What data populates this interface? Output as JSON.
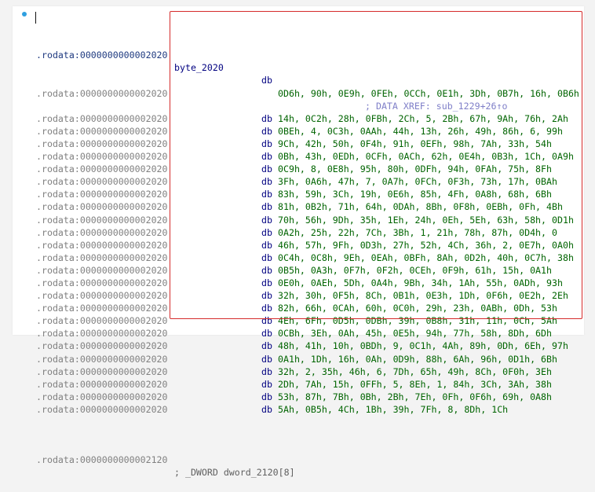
{
  "accent": "#d52b2b",
  "listing": {
    "label": "byte_2020",
    "operator": "db",
    "xref": "; DATA XREF: sub_1229+26↑o",
    "first_address": ".rodata:0000000000002020",
    "rows": [
      {
        "addr": ".rodata:0000000000002020",
        "vals": "0D6h, 90h, 0E9h, 0FEh, 0CCh, 0E1h, 3Dh, 0B7h, 16h, 0B6h"
      },
      {
        "addr": ".rodata:0000000000002020",
        "vals": ""
      },
      {
        "addr": ".rodata:0000000000002020",
        "vals": "14h, 0C2h, 28h, 0FBh, 2Ch, 5, 2Bh, 67h, 9Ah, 76h, 2Ah"
      },
      {
        "addr": ".rodata:0000000000002020",
        "vals": "0BEh, 4, 0C3h, 0AAh, 44h, 13h, 26h, 49h, 86h, 6, 99h"
      },
      {
        "addr": ".rodata:0000000000002020",
        "vals": "9Ch, 42h, 50h, 0F4h, 91h, 0EFh, 98h, 7Ah, 33h, 54h"
      },
      {
        "addr": ".rodata:0000000000002020",
        "vals": "0Bh, 43h, 0EDh, 0CFh, 0ACh, 62h, 0E4h, 0B3h, 1Ch, 0A9h"
      },
      {
        "addr": ".rodata:0000000000002020",
        "vals": "0C9h, 8, 0E8h, 95h, 80h, 0DFh, 94h, 0FAh, 75h, 8Fh"
      },
      {
        "addr": ".rodata:0000000000002020",
        "vals": "3Fh, 0A6h, 47h, 7, 0A7h, 0FCh, 0F3h, 73h, 17h, 0BAh"
      },
      {
        "addr": ".rodata:0000000000002020",
        "vals": "83h, 59h, 3Ch, 19h, 0E6h, 85h, 4Fh, 0A8h, 68h, 6Bh"
      },
      {
        "addr": ".rodata:0000000000002020",
        "vals": "81h, 0B2h, 71h, 64h, 0DAh, 8Bh, 0F8h, 0EBh, 0Fh, 4Bh"
      },
      {
        "addr": ".rodata:0000000000002020",
        "vals": "70h, 56h, 9Dh, 35h, 1Eh, 24h, 0Eh, 5Eh, 63h, 58h, 0D1h"
      },
      {
        "addr": ".rodata:0000000000002020",
        "vals": "0A2h, 25h, 22h, 7Ch, 3Bh, 1, 21h, 78h, 87h, 0D4h, 0"
      },
      {
        "addr": ".rodata:0000000000002020",
        "vals": "46h, 57h, 9Fh, 0D3h, 27h, 52h, 4Ch, 36h, 2, 0E7h, 0A0h"
      },
      {
        "addr": ".rodata:0000000000002020",
        "vals": "0C4h, 0C8h, 9Eh, 0EAh, 0BFh, 8Ah, 0D2h, 40h, 0C7h, 38h"
      },
      {
        "addr": ".rodata:0000000000002020",
        "vals": "0B5h, 0A3h, 0F7h, 0F2h, 0CEh, 0F9h, 61h, 15h, 0A1h"
      },
      {
        "addr": ".rodata:0000000000002020",
        "vals": "0E0h, 0AEh, 5Dh, 0A4h, 9Bh, 34h, 1Ah, 55h, 0ADh, 93h"
      },
      {
        "addr": ".rodata:0000000000002020",
        "vals": "32h, 30h, 0F5h, 8Ch, 0B1h, 0E3h, 1Dh, 0F6h, 0E2h, 2Eh"
      },
      {
        "addr": ".rodata:0000000000002020",
        "vals": "82h, 66h, 0CAh, 60h, 0C0h, 29h, 23h, 0ABh, 0Dh, 53h"
      },
      {
        "addr": ".rodata:0000000000002020",
        "vals": "4Eh, 6Fh, 0D5h, 0DBh, 39h, 0B8h, 31h, 11h, 0Ch, 5Ah"
      },
      {
        "addr": ".rodata:0000000000002020",
        "vals": "0CBh, 3Eh, 0Ah, 45h, 0E5h, 94h, 77h, 58h, 8Dh, 6Dh"
      },
      {
        "addr": ".rodata:0000000000002020",
        "vals": "48h, 41h, 10h, 0BDh, 9, 0C1h, 4Ah, 89h, 0Dh, 6Eh, 97h"
      },
      {
        "addr": ".rodata:0000000000002020",
        "vals": "0A1h, 1Dh, 16h, 0Ah, 0D9h, 88h, 6Ah, 96h, 0D1h, 6Bh"
      },
      {
        "addr": ".rodata:0000000000002020",
        "vals": "32h, 2, 35h, 46h, 6, 7Dh, 65h, 49h, 8Ch, 0F0h, 3Eh"
      },
      {
        "addr": ".rodata:0000000000002020",
        "vals": "2Dh, 7Ah, 15h, 0FFh, 5, 8Eh, 1, 84h, 3Ch, 3Ah, 38h"
      },
      {
        "addr": ".rodata:0000000000002020",
        "vals": "53h, 87h, 7Bh, 0Bh, 2Bh, 7Eh, 0Fh, 0F6h, 69h, 0A8h"
      },
      {
        "addr": ".rodata:0000000000002020",
        "vals": "5Ah, 0B5h, 4Ch, 1Bh, 39h, 7Fh, 8, 8Dh, 1Ch"
      }
    ],
    "last_row": {
      "addr": ".rodata:0000000000002120",
      "text": "; _DWORD dword_2120[8]"
    }
  }
}
